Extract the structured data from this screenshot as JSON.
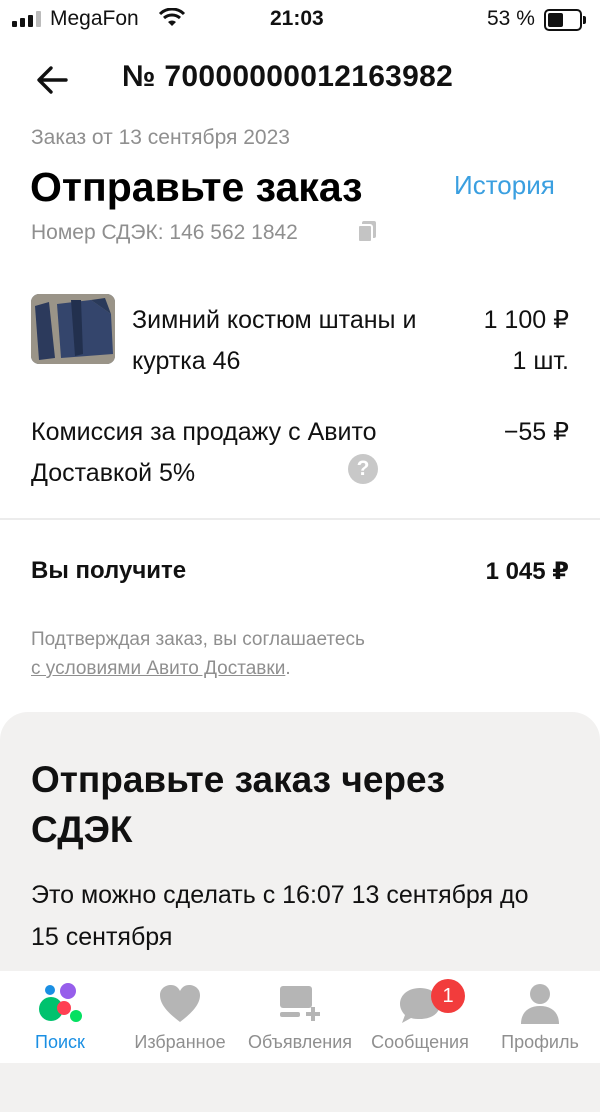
{
  "status_bar": {
    "carrier": "MegaFon",
    "time": "21:03",
    "battery_percent": "53 %"
  },
  "header": {
    "order_number": "№ 70000000012163982"
  },
  "order": {
    "date": "Заказ от 13 сентября 2023",
    "title": "Отправьте заказ",
    "history_link": "История",
    "cdek_number": "Номер СДЭК: 146 562 1842"
  },
  "item": {
    "name": "Зимний костюм штаны и куртка 46",
    "price": "1 100 ₽",
    "quantity": "1 шт."
  },
  "fee": {
    "label": "Комиссия за продажу с Авито Доставкой 5%",
    "value": "−55 ₽",
    "help_symbol": "?"
  },
  "receive": {
    "label": "Вы получите",
    "value": "1 045 ₽"
  },
  "terms": {
    "text": "Подтверждая заказ, вы соглашаетесь ",
    "link": "с условиями Авито Доставки",
    "end": "."
  },
  "card": {
    "title": "Отправьте заказ через СДЭК",
    "text": "Это можно сделать с 16:07 13 сентября до 15 сентября"
  },
  "nav": {
    "items": [
      {
        "label": "Поиск",
        "icon": "search-dots-icon",
        "active": true
      },
      {
        "label": "Избранное",
        "icon": "heart-icon",
        "active": false
      },
      {
        "label": "Объявления",
        "icon": "ads-list-icon",
        "active": false
      },
      {
        "label": "Сообщения",
        "icon": "chat-icon",
        "active": false,
        "badge": "1"
      },
      {
        "label": "Профиль",
        "icon": "profile-icon",
        "active": false
      }
    ]
  },
  "colors": {
    "accent": "#1a8fe3",
    "link": "#3a9fe0",
    "badge": "#f23c3c",
    "muted": "#8f8f8f"
  }
}
